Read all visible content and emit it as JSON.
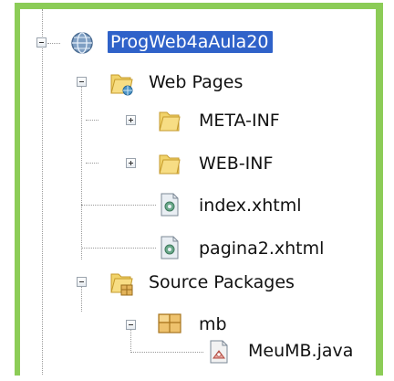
{
  "tree": {
    "project": {
      "label": "ProgWeb4aAula20",
      "icon": "globe-project-icon",
      "selected": true
    },
    "web_pages": {
      "label": "Web Pages",
      "icon": "web-pages-folder-icon",
      "children": [
        {
          "label": "META-INF",
          "icon": "folder-icon",
          "expandable": true
        },
        {
          "label": "WEB-INF",
          "icon": "folder-icon",
          "expandable": true
        },
        {
          "label": "index.xhtml",
          "icon": "xhtml-file-icon"
        },
        {
          "label": "pagina2.xhtml",
          "icon": "xhtml-file-icon"
        }
      ]
    },
    "source_packages": {
      "label": "Source Packages",
      "icon": "source-packages-icon",
      "children": [
        {
          "label": "mb",
          "icon": "package-icon",
          "expanded": true,
          "children": [
            {
              "label": "MeuMB.java",
              "icon": "java-file-icon"
            }
          ]
        }
      ]
    }
  },
  "colors": {
    "frame": "#8ccc57",
    "selection": "#2f62c9"
  }
}
